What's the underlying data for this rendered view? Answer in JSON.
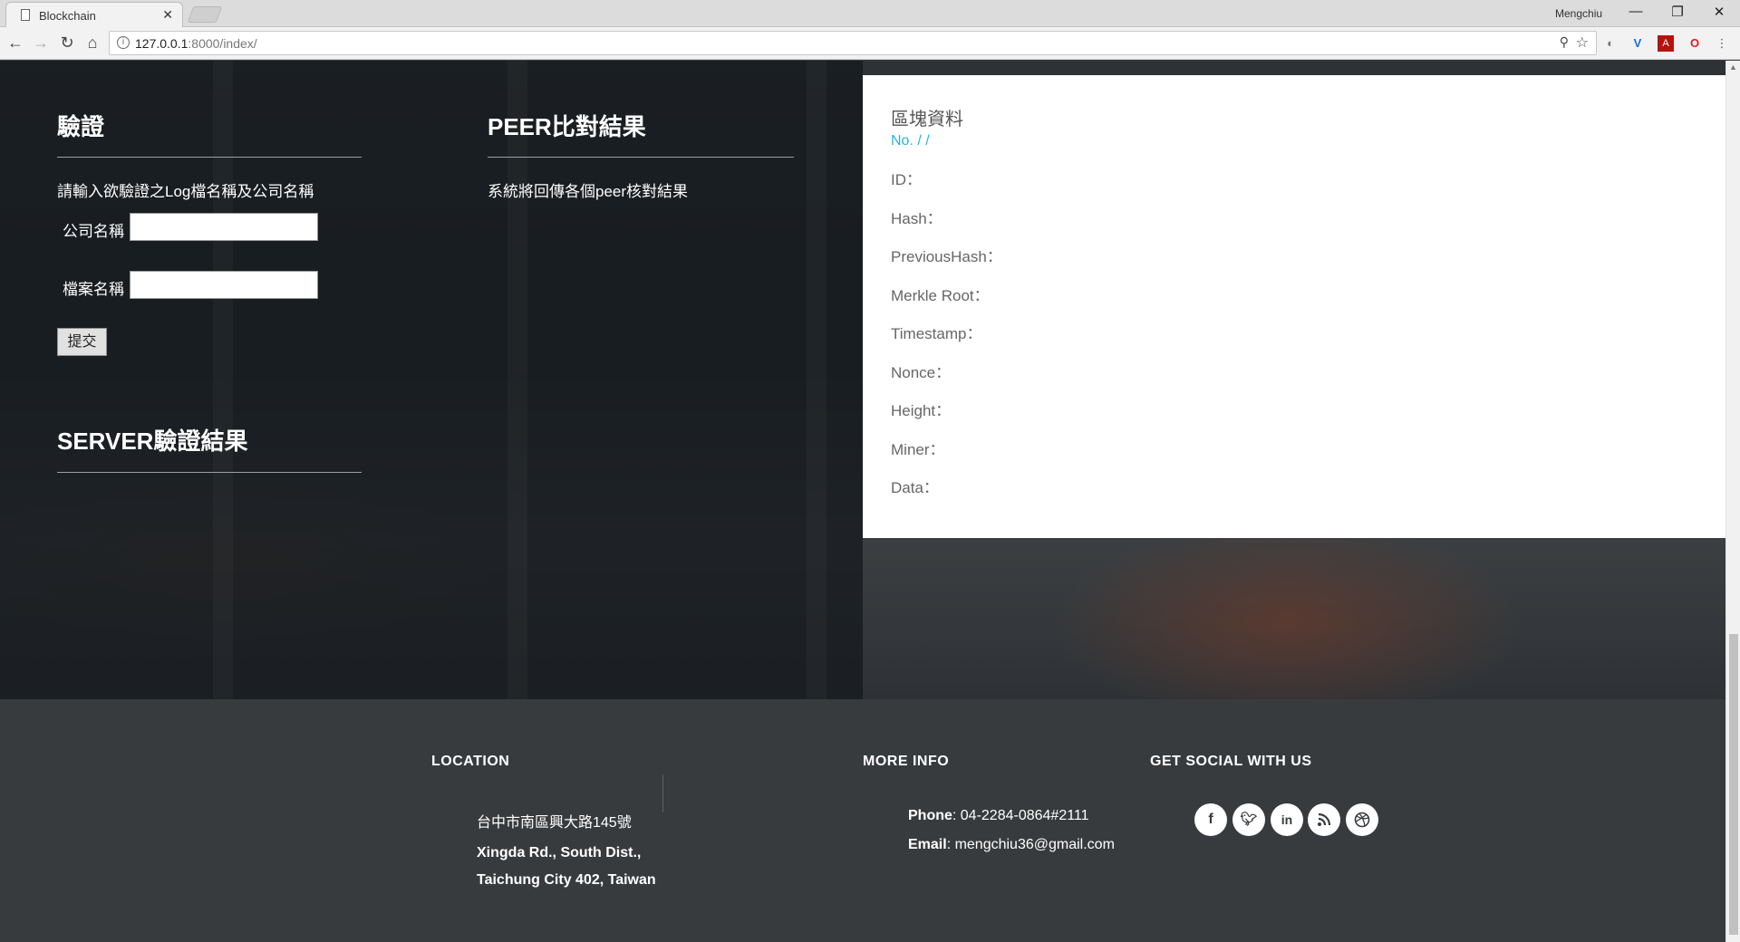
{
  "browser": {
    "tab_title": "Blockchain",
    "tab_close": "✕",
    "profile_name": "Mengchiu",
    "url_host": "127.0.0.1",
    "url_rest": ":8000/index/",
    "window_controls": [
      "—",
      "❐",
      "✕"
    ]
  },
  "verify": {
    "title": "驗證",
    "instruction": "請輸入欲驗證之Log檔名稱及公司名稱",
    "company_label": "公司名稱",
    "company_value": "",
    "file_label": "檔案名稱",
    "file_value": "",
    "submit_label": "提交"
  },
  "server_result": {
    "title": "SERVER驗證結果"
  },
  "peer": {
    "title": "PEER比對結果",
    "description": "系統將回傳各個peer核對結果"
  },
  "block": {
    "title": "區塊資料",
    "number": "No. / /",
    "fields": [
      "ID：",
      "Hash：",
      "PreviousHash：",
      "Merkle Root：",
      "Timestamp：",
      "Nonce：",
      "Height：",
      "Miner：",
      "Data："
    ]
  },
  "footer": {
    "location": {
      "heading": "LOCATION",
      "address_zh": "台中市南區興大路145號",
      "address_en_1": "Xingda Rd., South Dist.,",
      "address_en_2": "Taichung City 402, Taiwan"
    },
    "more_info": {
      "heading": "MORE INFO",
      "phone_label": "Phone",
      "phone": ": 04-2284-0864#2111",
      "email_label": "Email",
      "email": ": mengchiu36@gmail.com"
    },
    "social": {
      "heading": "GET SOCIAL WITH US",
      "icons": [
        "facebook-icon",
        "twitter-icon",
        "linkedin-icon",
        "rss-icon",
        "dribbble-icon"
      ]
    }
  }
}
